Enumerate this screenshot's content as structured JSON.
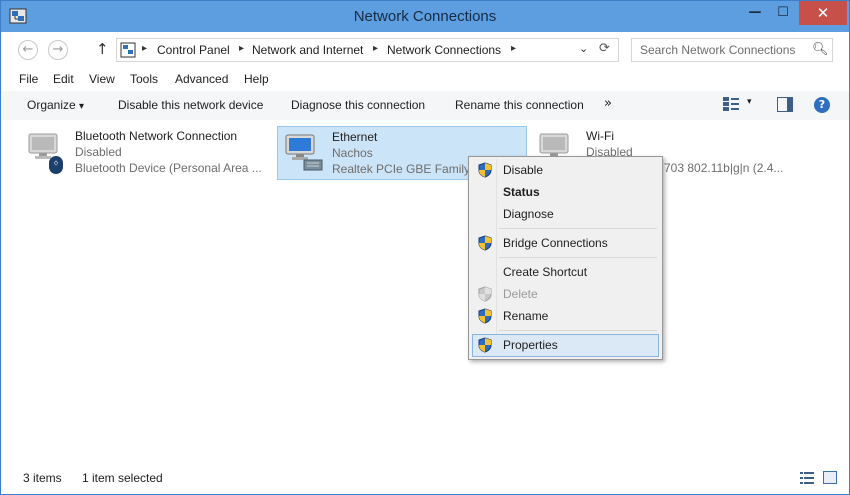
{
  "window": {
    "title": "Network Connections",
    "minimize_glyph": "—",
    "maximize_glyph": "☐",
    "close_glyph": "✕"
  },
  "nav": {
    "back_glyph": "←",
    "forward_glyph": "→",
    "up_glyph": "↑",
    "breadcrumbs": [
      "Control Panel",
      "Network and Internet",
      "Network Connections"
    ],
    "separator": "▸",
    "dropdown_glyph": "⌄",
    "refresh_glyph": "⟳"
  },
  "search": {
    "placeholder": "Search Network Connections",
    "icon": "magnifier-icon"
  },
  "menubar": {
    "items": [
      "File",
      "Edit",
      "View",
      "Tools",
      "Advanced",
      "Help"
    ]
  },
  "commandbar": {
    "organize": "Organize",
    "organize_arrow": "▾",
    "disable": "Disable this network device",
    "diagnose": "Diagnose this connection",
    "rename": "Rename this connection",
    "more": "»",
    "view_arrow": "▾",
    "help": "?"
  },
  "connections": [
    {
      "name": "Bluetooth Network Connection",
      "status": "Disabled",
      "device": "Bluetooth Device (Personal Area ...",
      "badge": "bluetooth-icon",
      "selected": false
    },
    {
      "name": "Ethernet",
      "status": "Nachos",
      "device": "Realtek PCIe GBE Family C",
      "badge": "network-cable-icon",
      "selected": true
    },
    {
      "name": "Wi-Fi",
      "status": "Disabled",
      "device": "703 802.11b|g|n (2.4...",
      "badge": "",
      "selected": false
    }
  ],
  "context_menu": {
    "items": [
      {
        "label": "Disable",
        "shield": true,
        "bold": false,
        "disabled": false
      },
      {
        "label": "Status",
        "shield": false,
        "bold": true,
        "disabled": false
      },
      {
        "label": "Diagnose",
        "shield": false,
        "bold": false,
        "disabled": false
      },
      {
        "label": "Bridge Connections",
        "shield": true,
        "bold": false,
        "disabled": false
      },
      {
        "label": "Create Shortcut",
        "shield": false,
        "bold": false,
        "disabled": false
      },
      {
        "label": "Delete",
        "shield": true,
        "bold": false,
        "disabled": true
      },
      {
        "label": "Rename",
        "shield": true,
        "bold": false,
        "disabled": false
      },
      {
        "label": "Properties",
        "shield": true,
        "bold": false,
        "disabled": false,
        "highlighted": true
      }
    ]
  },
  "statusbar": {
    "items_count": "3 items",
    "selection": "1 item selected"
  },
  "colors": {
    "titlebar": "#5c9ee0",
    "close_button": "#c7504a",
    "selection": "#cce4f7",
    "menu_bg": "#f0f0f0"
  }
}
